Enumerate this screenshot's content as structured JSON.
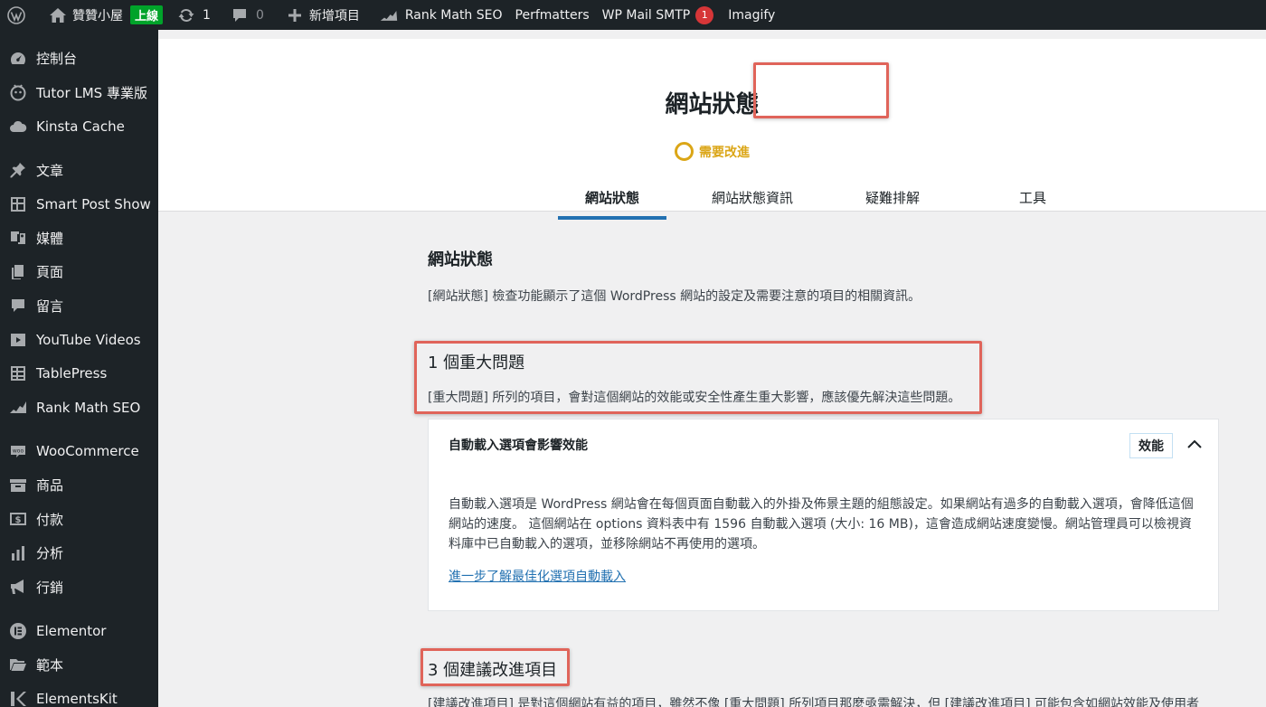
{
  "adminbar": {
    "site_name": "贊贊小屋",
    "live_label": "上線",
    "updates_count": "1",
    "comments_count": "0",
    "new_label": "新增項目",
    "rankmath_label": "Rank Math SEO",
    "perfmatters_label": "Perfmatters",
    "wpmail_label": "WP Mail SMTP",
    "wpmail_count": "1",
    "imagify_label": "Imagify"
  },
  "sidebar": {
    "items": [
      {
        "label": "控制台",
        "icon": "dashboard-icon"
      },
      {
        "label": "Tutor LMS 專業版",
        "icon": "tutor-icon"
      },
      {
        "label": "Kinsta Cache",
        "icon": "cloud-icon"
      },
      {
        "label": "文章",
        "icon": "pin-icon"
      },
      {
        "label": "Smart Post Show",
        "icon": "grid-icon"
      },
      {
        "label": "媒體",
        "icon": "media-icon"
      },
      {
        "label": "頁面",
        "icon": "page-icon"
      },
      {
        "label": "留言",
        "icon": "comment-icon"
      },
      {
        "label": "YouTube Videos",
        "icon": "video-icon"
      },
      {
        "label": "TablePress",
        "icon": "table-icon"
      },
      {
        "label": "Rank Math SEO",
        "icon": "rankmath-icon"
      },
      {
        "label": "WooCommerce",
        "icon": "woo-icon"
      },
      {
        "label": "商品",
        "icon": "archive-icon"
      },
      {
        "label": "付款",
        "icon": "money-icon"
      },
      {
        "label": "分析",
        "icon": "chart-icon"
      },
      {
        "label": "行銷",
        "icon": "megaphone-icon"
      },
      {
        "label": "Elementor",
        "icon": "elementor-icon"
      },
      {
        "label": "範本",
        "icon": "folder-icon"
      },
      {
        "label": "ElementsKit",
        "icon": "elementskit-icon"
      }
    ]
  },
  "header": {
    "title": "網站狀態",
    "status": "需要改進",
    "tabs": [
      "網站狀態",
      "網站狀態資訊",
      "疑難排解",
      "工具"
    ]
  },
  "main": {
    "section_title": "網站狀態",
    "section_desc": "[網站狀態] 檢查功能顯示了這個 WordPress 網站的設定及需要注意的項目的相關資訊。",
    "critical_title": "1 個重大問題",
    "critical_desc": "[重大問題] 所列的項目，會對這個網站的效能或安全性產生重大影響，應該優先解決這些問題。",
    "accordion": {
      "title": "自動載入選項會影響效能",
      "badge": "效能",
      "body": "自動載入選項是 WordPress 網站會在每個頁面自動載入的外掛及佈景主題的組態設定。如果網站有過多的自動載入選項，會降低這個網站的速度。 這個網站在 options 資料表中有 1596 自動載入選項 (大小: 16 MB)，這會造成網站速度變慢。網站管理員可以檢視資料庫中已自動載入的選項，並移除網站不再使用的選項。",
      "link": "進一步了解最佳化選項自動載入"
    },
    "recommended_title": "3 個建議改進項目",
    "recommended_desc": "[建議改進項目] 是對這個網站有益的項目，雖然不像 [重大問題] 所列項目那麼亟需解決，但 [建議改進項目] 可能包含如網站效能及使用者"
  }
}
